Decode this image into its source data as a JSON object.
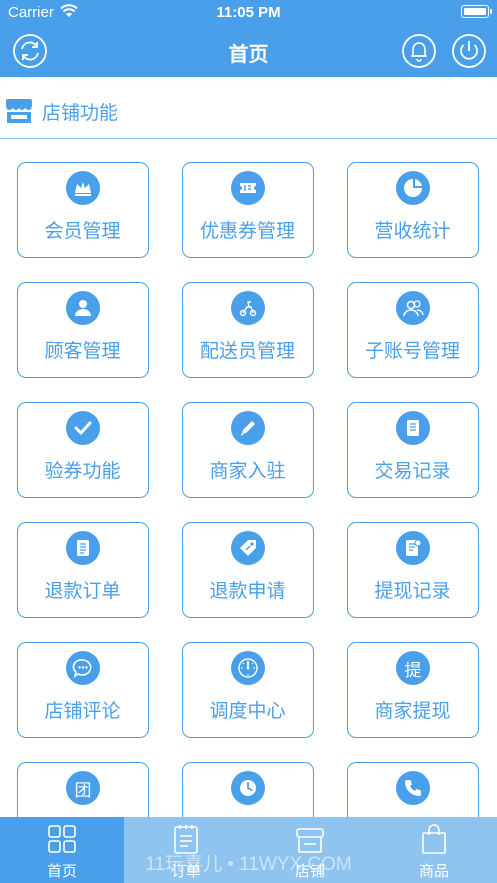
{
  "status_bar": {
    "carrier": "Carrier",
    "time": "11:05 PM"
  },
  "nav": {
    "title": "首页"
  },
  "section": {
    "title": "店铺功能"
  },
  "menu": [
    {
      "label": "会员管理",
      "icon": "crown-icon"
    },
    {
      "label": "优惠券管理",
      "icon": "coupon-icon"
    },
    {
      "label": "营收统计",
      "icon": "pie-chart-icon"
    },
    {
      "label": "顾客管理",
      "icon": "user-icon"
    },
    {
      "label": "配送员管理",
      "icon": "scooter-icon"
    },
    {
      "label": "子账号管理",
      "icon": "users-icon"
    },
    {
      "label": "验券功能",
      "icon": "checkmark-icon"
    },
    {
      "label": "商家入驻",
      "icon": "pencil-icon"
    },
    {
      "label": "交易记录",
      "icon": "document-icon"
    },
    {
      "label": "退款订单",
      "icon": "list-icon"
    },
    {
      "label": "退款申请",
      "icon": "tag-icon"
    },
    {
      "label": "提现记录",
      "icon": "receipt-icon"
    },
    {
      "label": "店铺评论",
      "icon": "chat-icon"
    },
    {
      "label": "调度中心",
      "icon": "dial-icon"
    },
    {
      "label": "商家提现",
      "icon": "withdraw-icon",
      "glyph": "提"
    },
    {
      "label": "",
      "icon": "group-icon",
      "glyph": "团"
    },
    {
      "label": "",
      "icon": "clock-icon"
    },
    {
      "label": "",
      "icon": "phone-icon"
    }
  ],
  "tabs": [
    {
      "label": "首页",
      "icon": "grid-icon",
      "active": true
    },
    {
      "label": "订单",
      "icon": "order-notepad-icon",
      "active": false
    },
    {
      "label": "店铺",
      "icon": "store-icon",
      "active": false
    },
    {
      "label": "商品",
      "icon": "shopping-bag-icon",
      "active": false
    }
  ],
  "watermark": "11玩喜儿 • 11WYX.COM",
  "colors": {
    "primary": "#4a9fea",
    "tab_bar": "#8fc3f0",
    "background": "#ffffff"
  }
}
